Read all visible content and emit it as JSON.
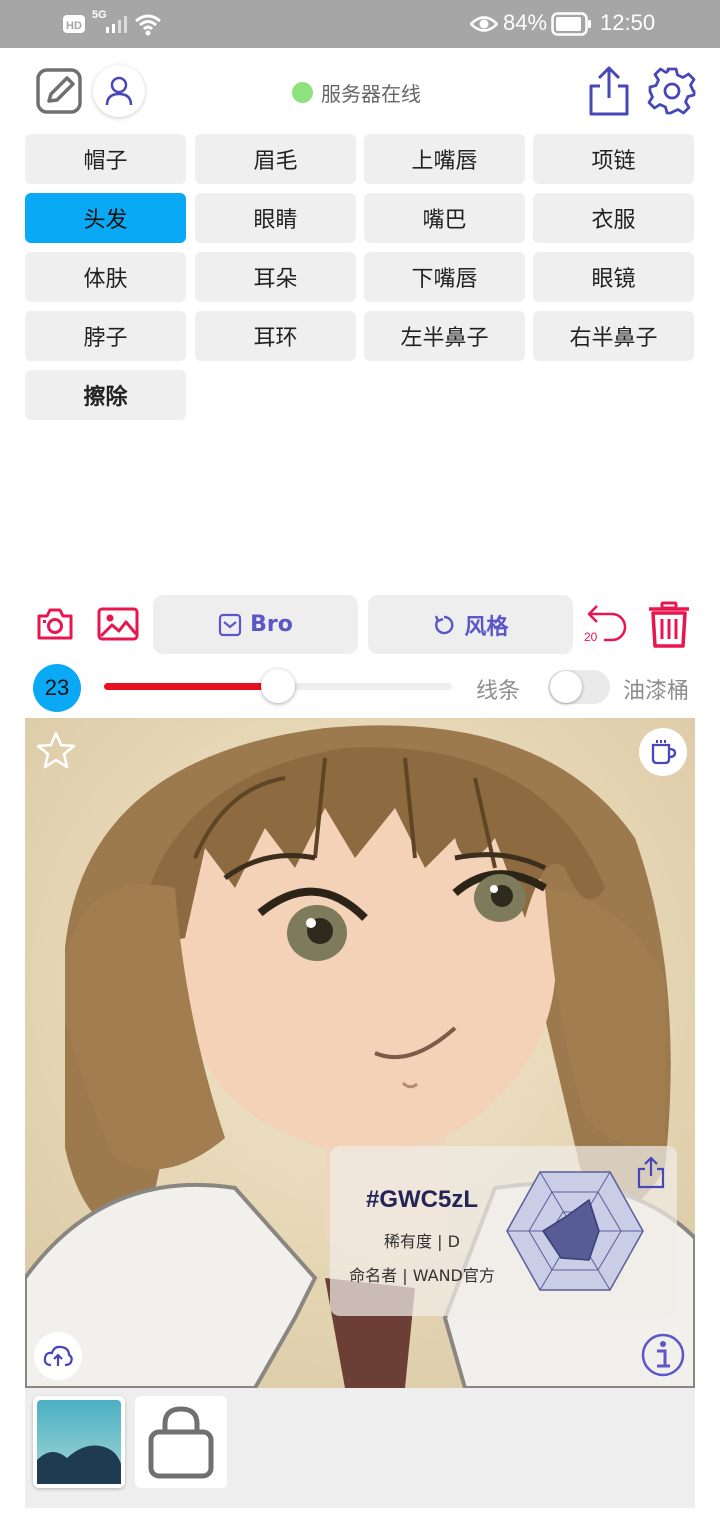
{
  "status_bar": {
    "network": "5G",
    "battery": "84%",
    "time": "12:50"
  },
  "header": {
    "server_status": "服务器在线",
    "status_color": "#8ee27d",
    "icons": [
      "edit-icon",
      "user-icon",
      "share-icon",
      "gear-icon"
    ]
  },
  "categories": [
    {
      "label": "帽子",
      "active": false
    },
    {
      "label": "眉毛",
      "active": false
    },
    {
      "label": "上嘴唇",
      "active": false
    },
    {
      "label": "项链",
      "active": false
    },
    {
      "label": "头发",
      "active": true
    },
    {
      "label": "眼睛",
      "active": false
    },
    {
      "label": "嘴巴",
      "active": false
    },
    {
      "label": "衣服",
      "active": false
    },
    {
      "label": "体肤",
      "active": false
    },
    {
      "label": "耳朵",
      "active": false
    },
    {
      "label": "下嘴唇",
      "active": false
    },
    {
      "label": "眼镜",
      "active": false
    },
    {
      "label": "脖子",
      "active": false
    },
    {
      "label": "耳环",
      "active": false
    },
    {
      "label": "左半鼻子",
      "active": false
    },
    {
      "label": "右半鼻子",
      "active": false
    },
    {
      "label": "擦除",
      "active": false
    }
  ],
  "toolbar": {
    "preset_label": "Bro",
    "style_label": "风格",
    "undo_count": "20",
    "accent": "#e8164f",
    "purple": "#5b57c8"
  },
  "brush": {
    "size": "23",
    "slider_fraction": 0.5,
    "line_label": "线条",
    "bucket_label": "油漆桶",
    "bucket_enabled": false
  },
  "result_card": {
    "code": "#GWC5zL",
    "rarity": "稀有度 | D",
    "namer": "命名者 | WAND官方"
  },
  "bottom": {
    "thumbnails": [
      "landscape-thumbnail",
      "bag-icon"
    ]
  }
}
